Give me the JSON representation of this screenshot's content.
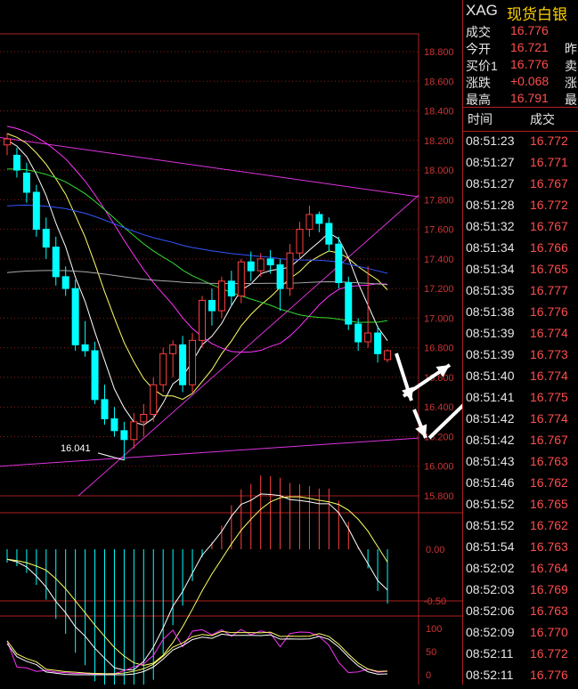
{
  "symbol": {
    "code": "XAG",
    "name": "现货白银"
  },
  "quote_rows": [
    {
      "label": "成交",
      "value": "16.776",
      "extra": ""
    },
    {
      "label": "今开",
      "value": "16.721",
      "extra": "昨"
    },
    {
      "label": "买价1",
      "value": "16.776",
      "extra": "卖"
    },
    {
      "label": "涨跌",
      "value": "+0.068",
      "extra": "涨"
    },
    {
      "label": "最高",
      "value": "16.791",
      "extra": "最"
    }
  ],
  "tick_header": {
    "time": "时间",
    "price": "成交"
  },
  "ticks": [
    {
      "time": "08:51:23",
      "price": "16.772"
    },
    {
      "time": "08:51:27",
      "price": "16.771"
    },
    {
      "time": "08:51:27",
      "price": "16.767"
    },
    {
      "time": "08:51:28",
      "price": "16.772"
    },
    {
      "time": "08:51:32",
      "price": "16.767"
    },
    {
      "time": "08:51:34",
      "price": "16.766"
    },
    {
      "time": "08:51:34",
      "price": "16.765"
    },
    {
      "time": "08:51:35",
      "price": "16.777"
    },
    {
      "time": "08:51:38",
      "price": "16.776"
    },
    {
      "time": "08:51:39",
      "price": "16.774"
    },
    {
      "time": "08:51:39",
      "price": "16.773"
    },
    {
      "time": "08:51:40",
      "price": "16.774"
    },
    {
      "time": "08:51:41",
      "price": "16.775"
    },
    {
      "time": "08:51:42",
      "price": "16.774"
    },
    {
      "time": "08:51:42",
      "price": "16.767"
    },
    {
      "time": "08:51:43",
      "price": "16.763"
    },
    {
      "time": "08:51:46",
      "price": "16.762"
    },
    {
      "time": "08:51:52",
      "price": "16.765"
    },
    {
      "time": "08:51:52",
      "price": "16.762"
    },
    {
      "time": "08:51:54",
      "price": "16.763"
    },
    {
      "time": "08:52:02",
      "price": "16.764"
    },
    {
      "time": "08:52:03",
      "price": "16.769"
    },
    {
      "time": "08:52:06",
      "price": "16.763"
    },
    {
      "time": "08:52:09",
      "price": "16.770"
    },
    {
      "time": "08:52:11",
      "price": "16.772"
    },
    {
      "time": "08:52:11",
      "price": "16.776"
    }
  ],
  "colors": {
    "up": "#ff4040",
    "down": "#00ffff",
    "frame": "#b02020",
    "ma5": "#ffffff",
    "ma10": "#ffff66",
    "ma20": "#ff33ff",
    "ma30": "#33dd33",
    "ma60": "#3355ff",
    "ma120": "#aaaaaa",
    "trendline": "#dd33dd",
    "annotation": "#ffffff"
  },
  "chart_data": {
    "type": "candlestick",
    "price_axis_labels": [
      "18.800",
      "18.600",
      "18.400",
      "18.200",
      "18.000",
      "17.800",
      "17.600",
      "17.400",
      "17.200",
      "17.000",
      "16.800",
      "16.600",
      "16.400",
      "16.200",
      "16.000",
      "15.800"
    ],
    "ylim": [
      15.8,
      18.8
    ],
    "low_label": "16.041",
    "candles": [
      {
        "o": 18.17,
        "h": 18.25,
        "l": 18.1,
        "c": 18.21
      },
      {
        "o": 18.1,
        "h": 18.15,
        "l": 17.95,
        "c": 18.0
      },
      {
        "o": 17.98,
        "h": 18.05,
        "l": 17.78,
        "c": 17.85
      },
      {
        "o": 17.85,
        "h": 17.9,
        "l": 17.55,
        "c": 17.6
      },
      {
        "o": 17.6,
        "h": 17.68,
        "l": 17.4,
        "c": 17.48
      },
      {
        "o": 17.48,
        "h": 17.55,
        "l": 17.22,
        "c": 17.28
      },
      {
        "o": 17.28,
        "h": 17.35,
        "l": 17.15,
        "c": 17.2
      },
      {
        "o": 17.2,
        "h": 17.26,
        "l": 16.78,
        "c": 16.82
      },
      {
        "o": 16.82,
        "h": 16.98,
        "l": 16.74,
        "c": 16.78
      },
      {
        "o": 16.78,
        "h": 16.84,
        "l": 16.42,
        "c": 16.45
      },
      {
        "o": 16.45,
        "h": 16.55,
        "l": 16.28,
        "c": 16.32
      },
      {
        "o": 16.32,
        "h": 16.4,
        "l": 16.2,
        "c": 16.24
      },
      {
        "o": 16.24,
        "h": 16.3,
        "l": 16.04,
        "c": 16.18
      },
      {
        "o": 16.18,
        "h": 16.36,
        "l": 16.12,
        "c": 16.3
      },
      {
        "o": 16.3,
        "h": 16.42,
        "l": 16.2,
        "c": 16.35
      },
      {
        "o": 16.35,
        "h": 16.6,
        "l": 16.3,
        "c": 16.55
      },
      {
        "o": 16.55,
        "h": 16.8,
        "l": 16.5,
        "c": 16.76
      },
      {
        "o": 16.76,
        "h": 16.85,
        "l": 16.6,
        "c": 16.82
      },
      {
        "o": 16.82,
        "h": 16.88,
        "l": 16.5,
        "c": 16.55
      },
      {
        "o": 16.55,
        "h": 16.9,
        "l": 16.5,
        "c": 16.85
      },
      {
        "o": 16.85,
        "h": 17.15,
        "l": 16.8,
        "c": 17.12
      },
      {
        "o": 17.12,
        "h": 17.2,
        "l": 16.95,
        "c": 17.05
      },
      {
        "o": 17.05,
        "h": 17.28,
        "l": 17.0,
        "c": 17.25
      },
      {
        "o": 17.25,
        "h": 17.32,
        "l": 17.08,
        "c": 17.15
      },
      {
        "o": 17.15,
        "h": 17.4,
        "l": 17.1,
        "c": 17.38
      },
      {
        "o": 17.38,
        "h": 17.45,
        "l": 17.25,
        "c": 17.32
      },
      {
        "o": 17.32,
        "h": 17.44,
        "l": 17.28,
        "c": 17.4
      },
      {
        "o": 17.4,
        "h": 17.46,
        "l": 17.3,
        "c": 17.36
      },
      {
        "o": 17.36,
        "h": 17.4,
        "l": 17.05,
        "c": 17.2
      },
      {
        "o": 17.2,
        "h": 17.5,
        "l": 17.15,
        "c": 17.44
      },
      {
        "o": 17.44,
        "h": 17.65,
        "l": 17.4,
        "c": 17.6
      },
      {
        "o": 17.6,
        "h": 17.76,
        "l": 17.55,
        "c": 17.7
      },
      {
        "o": 17.7,
        "h": 17.72,
        "l": 17.58,
        "c": 17.64
      },
      {
        "o": 17.64,
        "h": 17.68,
        "l": 17.45,
        "c": 17.5
      },
      {
        "o": 17.5,
        "h": 17.55,
        "l": 17.2,
        "c": 17.24
      },
      {
        "o": 17.24,
        "h": 17.28,
        "l": 16.92,
        "c": 16.96
      },
      {
        "o": 16.96,
        "h": 17.0,
        "l": 16.78,
        "c": 16.84
      },
      {
        "o": 16.84,
        "h": 17.35,
        "l": 16.8,
        "c": 16.9
      },
      {
        "o": 16.9,
        "h": 16.95,
        "l": 16.7,
        "c": 16.76
      },
      {
        "o": 16.72,
        "h": 16.79,
        "l": 16.7,
        "c": 16.78
      }
    ],
    "macd": {
      "zero_label": "0.00",
      "low_label": "-0.50"
    },
    "kdj": {
      "labels": [
        "100",
        "50",
        "0"
      ]
    }
  }
}
